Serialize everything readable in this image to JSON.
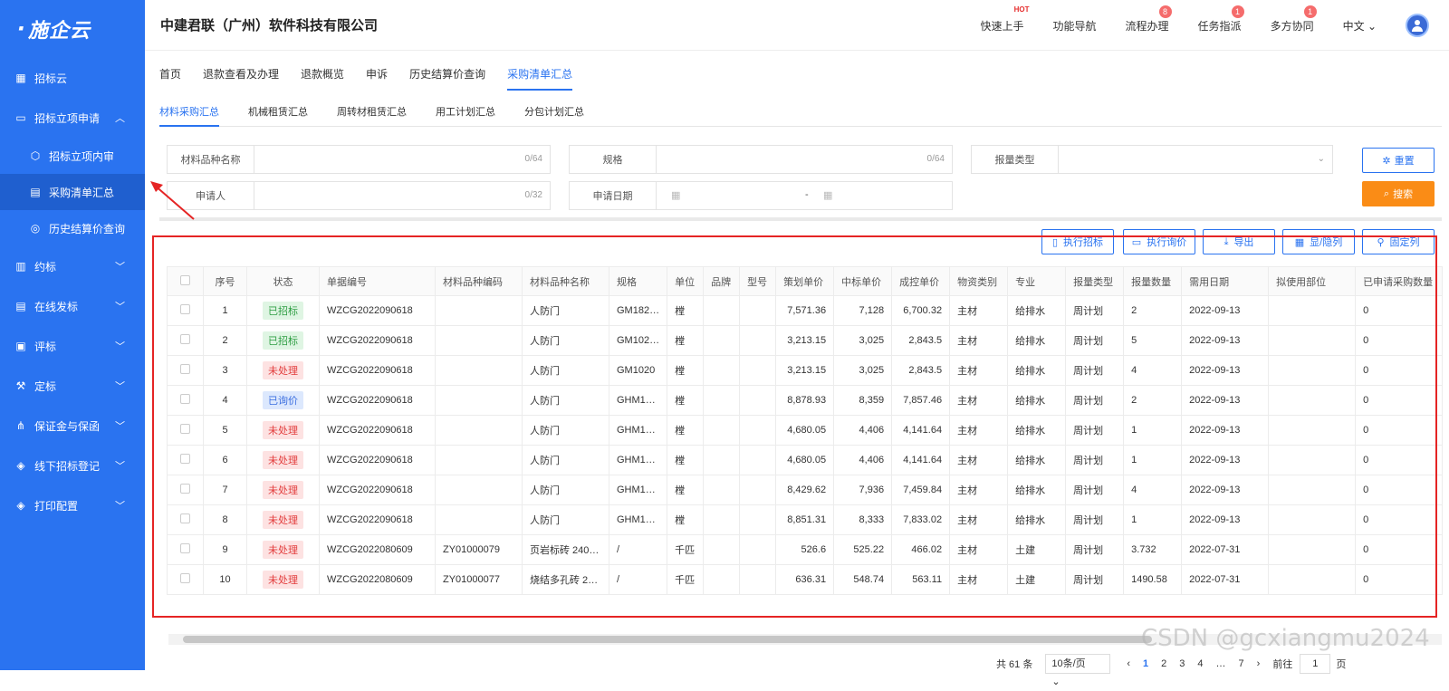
{
  "app": {
    "logo_text": "施企云",
    "company": "中建君联（广州）软件科技有限公司"
  },
  "sidebar": {
    "items": [
      {
        "label": "招标云",
        "icon": "grid-icon",
        "expandable": false
      },
      {
        "label": "招标立项申请",
        "icon": "folder-icon",
        "expandable": true,
        "expanded": true
      },
      {
        "label": "招标立项内审",
        "icon": "cube-icon",
        "sub": true
      },
      {
        "label": "采购清单汇总",
        "icon": "table-icon",
        "sub": true,
        "active": true
      },
      {
        "label": "历史结算价查询",
        "icon": "coins-icon",
        "sub": true
      },
      {
        "label": "约标",
        "icon": "book-icon",
        "expandable": true
      },
      {
        "label": "在线发标",
        "icon": "doc-icon",
        "expandable": true
      },
      {
        "label": "评标",
        "icon": "clipboard-icon",
        "expandable": true
      },
      {
        "label": "定标",
        "icon": "gavel-icon",
        "expandable": true
      },
      {
        "label": "保证金与保函",
        "icon": "share-icon",
        "expandable": true
      },
      {
        "label": "线下招标登记",
        "icon": "layers-icon",
        "expandable": true
      },
      {
        "label": "打印配置",
        "icon": "layers-icon",
        "expandable": true
      }
    ]
  },
  "topnav": {
    "quick_start": "快速上手",
    "hot": "HOT",
    "function_nav": "功能导航",
    "process": "流程办理",
    "process_badge": "8",
    "task": "任务指派",
    "task_badge": "1",
    "collab": "多方协同",
    "collab_badge": "1",
    "language": "中文"
  },
  "nav_tabs": [
    "首页",
    "退款查看及办理",
    "退款概览",
    "申诉",
    "历史结算价查询",
    "采购清单汇总"
  ],
  "sub_tabs": [
    "材料采购汇总",
    "机械租赁汇总",
    "周转材租赁汇总",
    "用工计划汇总",
    "分包计划汇总"
  ],
  "filters": {
    "material_name": {
      "label": "材料品种名称",
      "count": "0/64"
    },
    "spec": {
      "label": "规格",
      "count": "0/64"
    },
    "report_type": {
      "label": "报量类型"
    },
    "applicant": {
      "label": "申请人",
      "count": "0/32"
    },
    "apply_date": {
      "label": "申请日期",
      "range_sep": "-"
    }
  },
  "buttons": {
    "reset": "重置",
    "search": "搜索",
    "exec_bid": "执行招标",
    "exec_inquiry": "执行询价",
    "export": "导出",
    "toggle_cols": "显/隐列",
    "fix_cols": "固定列"
  },
  "table": {
    "columns": [
      "序号",
      "状态",
      "单据编号",
      "材料品种编码",
      "材料品种名称",
      "规格",
      "单位",
      "品牌",
      "型号",
      "策划单价",
      "中标单价",
      "成控单价",
      "物资类别",
      "专业",
      "报量类型",
      "报量数量",
      "需用日期",
      "拟使用部位",
      "已申请采购数量"
    ],
    "rows": [
      {
        "no": "1",
        "status": "已招标",
        "status_color": "green",
        "code": "WZCG2022090618",
        "mcode": "",
        "mname": "人防门",
        "spec": "GM182…",
        "unit": "樘",
        "brand": "",
        "model": "",
        "plan": "7,571.36",
        "bid": "7,128",
        "ctrl": "6,700.32",
        "cat": "主材",
        "major": "给排水",
        "rtype": "周计划",
        "qty": "2",
        "date": "2022-09-13",
        "part": "",
        "applied": "0"
      },
      {
        "no": "2",
        "status": "已招标",
        "status_color": "green",
        "code": "WZCG2022090618",
        "mcode": "",
        "mname": "人防门",
        "spec": "GM102…",
        "unit": "樘",
        "brand": "",
        "model": "",
        "plan": "3,213.15",
        "bid": "3,025",
        "ctrl": "2,843.5",
        "cat": "主材",
        "major": "给排水",
        "rtype": "周计划",
        "qty": "5",
        "date": "2022-09-13",
        "part": "",
        "applied": "0"
      },
      {
        "no": "3",
        "status": "未处理",
        "status_color": "red",
        "code": "WZCG2022090618",
        "mcode": "",
        "mname": "人防门",
        "spec": "GM1020",
        "unit": "樘",
        "brand": "",
        "model": "",
        "plan": "3,213.15",
        "bid": "3,025",
        "ctrl": "2,843.5",
        "cat": "主材",
        "major": "给排水",
        "rtype": "周计划",
        "qty": "4",
        "date": "2022-09-13",
        "part": "",
        "applied": "0"
      },
      {
        "no": "4",
        "status": "已询价",
        "status_color": "blue",
        "code": "WZCG2022090618",
        "mcode": "",
        "mname": "人防门",
        "spec": "GHM1…",
        "unit": "樘",
        "brand": "",
        "model": "",
        "plan": "8,878.93",
        "bid": "8,359",
        "ctrl": "7,857.46",
        "cat": "主材",
        "major": "给排水",
        "rtype": "周计划",
        "qty": "2",
        "date": "2022-09-13",
        "part": "",
        "applied": "0"
      },
      {
        "no": "5",
        "status": "未处理",
        "status_color": "red",
        "code": "WZCG2022090618",
        "mcode": "",
        "mname": "人防门",
        "spec": "GHM1…",
        "unit": "樘",
        "brand": "",
        "model": "",
        "plan": "4,680.05",
        "bid": "4,406",
        "ctrl": "4,141.64",
        "cat": "主材",
        "major": "给排水",
        "rtype": "周计划",
        "qty": "1",
        "date": "2022-09-13",
        "part": "",
        "applied": "0"
      },
      {
        "no": "6",
        "status": "未处理",
        "status_color": "red",
        "code": "WZCG2022090618",
        "mcode": "",
        "mname": "人防门",
        "spec": "GHM1…",
        "unit": "樘",
        "brand": "",
        "model": "",
        "plan": "4,680.05",
        "bid": "4,406",
        "ctrl": "4,141.64",
        "cat": "主材",
        "major": "给排水",
        "rtype": "周计划",
        "qty": "1",
        "date": "2022-09-13",
        "part": "",
        "applied": "0"
      },
      {
        "no": "7",
        "status": "未处理",
        "status_color": "red",
        "code": "WZCG2022090618",
        "mcode": "",
        "mname": "人防门",
        "spec": "GHM1…",
        "unit": "樘",
        "brand": "",
        "model": "",
        "plan": "8,429.62",
        "bid": "7,936",
        "ctrl": "7,459.84",
        "cat": "主材",
        "major": "给排水",
        "rtype": "周计划",
        "qty": "4",
        "date": "2022-09-13",
        "part": "",
        "applied": "0"
      },
      {
        "no": "8",
        "status": "未处理",
        "status_color": "red",
        "code": "WZCG2022090618",
        "mcode": "",
        "mname": "人防门",
        "spec": "GHM1…",
        "unit": "樘",
        "brand": "",
        "model": "",
        "plan": "8,851.31",
        "bid": "8,333",
        "ctrl": "7,833.02",
        "cat": "主材",
        "major": "给排水",
        "rtype": "周计划",
        "qty": "1",
        "date": "2022-09-13",
        "part": "",
        "applied": "0"
      },
      {
        "no": "9",
        "status": "未处理",
        "status_color": "red",
        "code": "WZCG2022080609",
        "mcode": "ZY01000079",
        "mname": "页岩标砖 240…",
        "spec": "/",
        "unit": "千匹",
        "brand": "",
        "model": "",
        "plan": "526.6",
        "bid": "525.22",
        "ctrl": "466.02",
        "cat": "主材",
        "major": "土建",
        "rtype": "周计划",
        "qty": "3.732",
        "date": "2022-07-31",
        "part": "",
        "applied": "0"
      },
      {
        "no": "10",
        "status": "未处理",
        "status_color": "red",
        "code": "WZCG2022080609",
        "mcode": "ZY01000077",
        "mname": "烧结多孔砖 2…",
        "spec": "/",
        "unit": "千匹",
        "brand": "",
        "model": "",
        "plan": "636.31",
        "bid": "548.74",
        "ctrl": "563.11",
        "cat": "主材",
        "major": "土建",
        "rtype": "周计划",
        "qty": "1490.58",
        "date": "2022-07-31",
        "part": "",
        "applied": "0"
      }
    ]
  },
  "pagination": {
    "total": "共 61 条",
    "page_size": "10条/页",
    "pages": [
      "1",
      "2",
      "3",
      "4",
      "…",
      "7"
    ],
    "current": "1",
    "goto_label": "前往",
    "goto_value": "1",
    "page_suffix": "页"
  },
  "watermark": "CSDN @gcxiangmu2024",
  "colors": {
    "primary": "#2a73f0",
    "orange": "#fa8c16",
    "highlight": "#e52424"
  }
}
